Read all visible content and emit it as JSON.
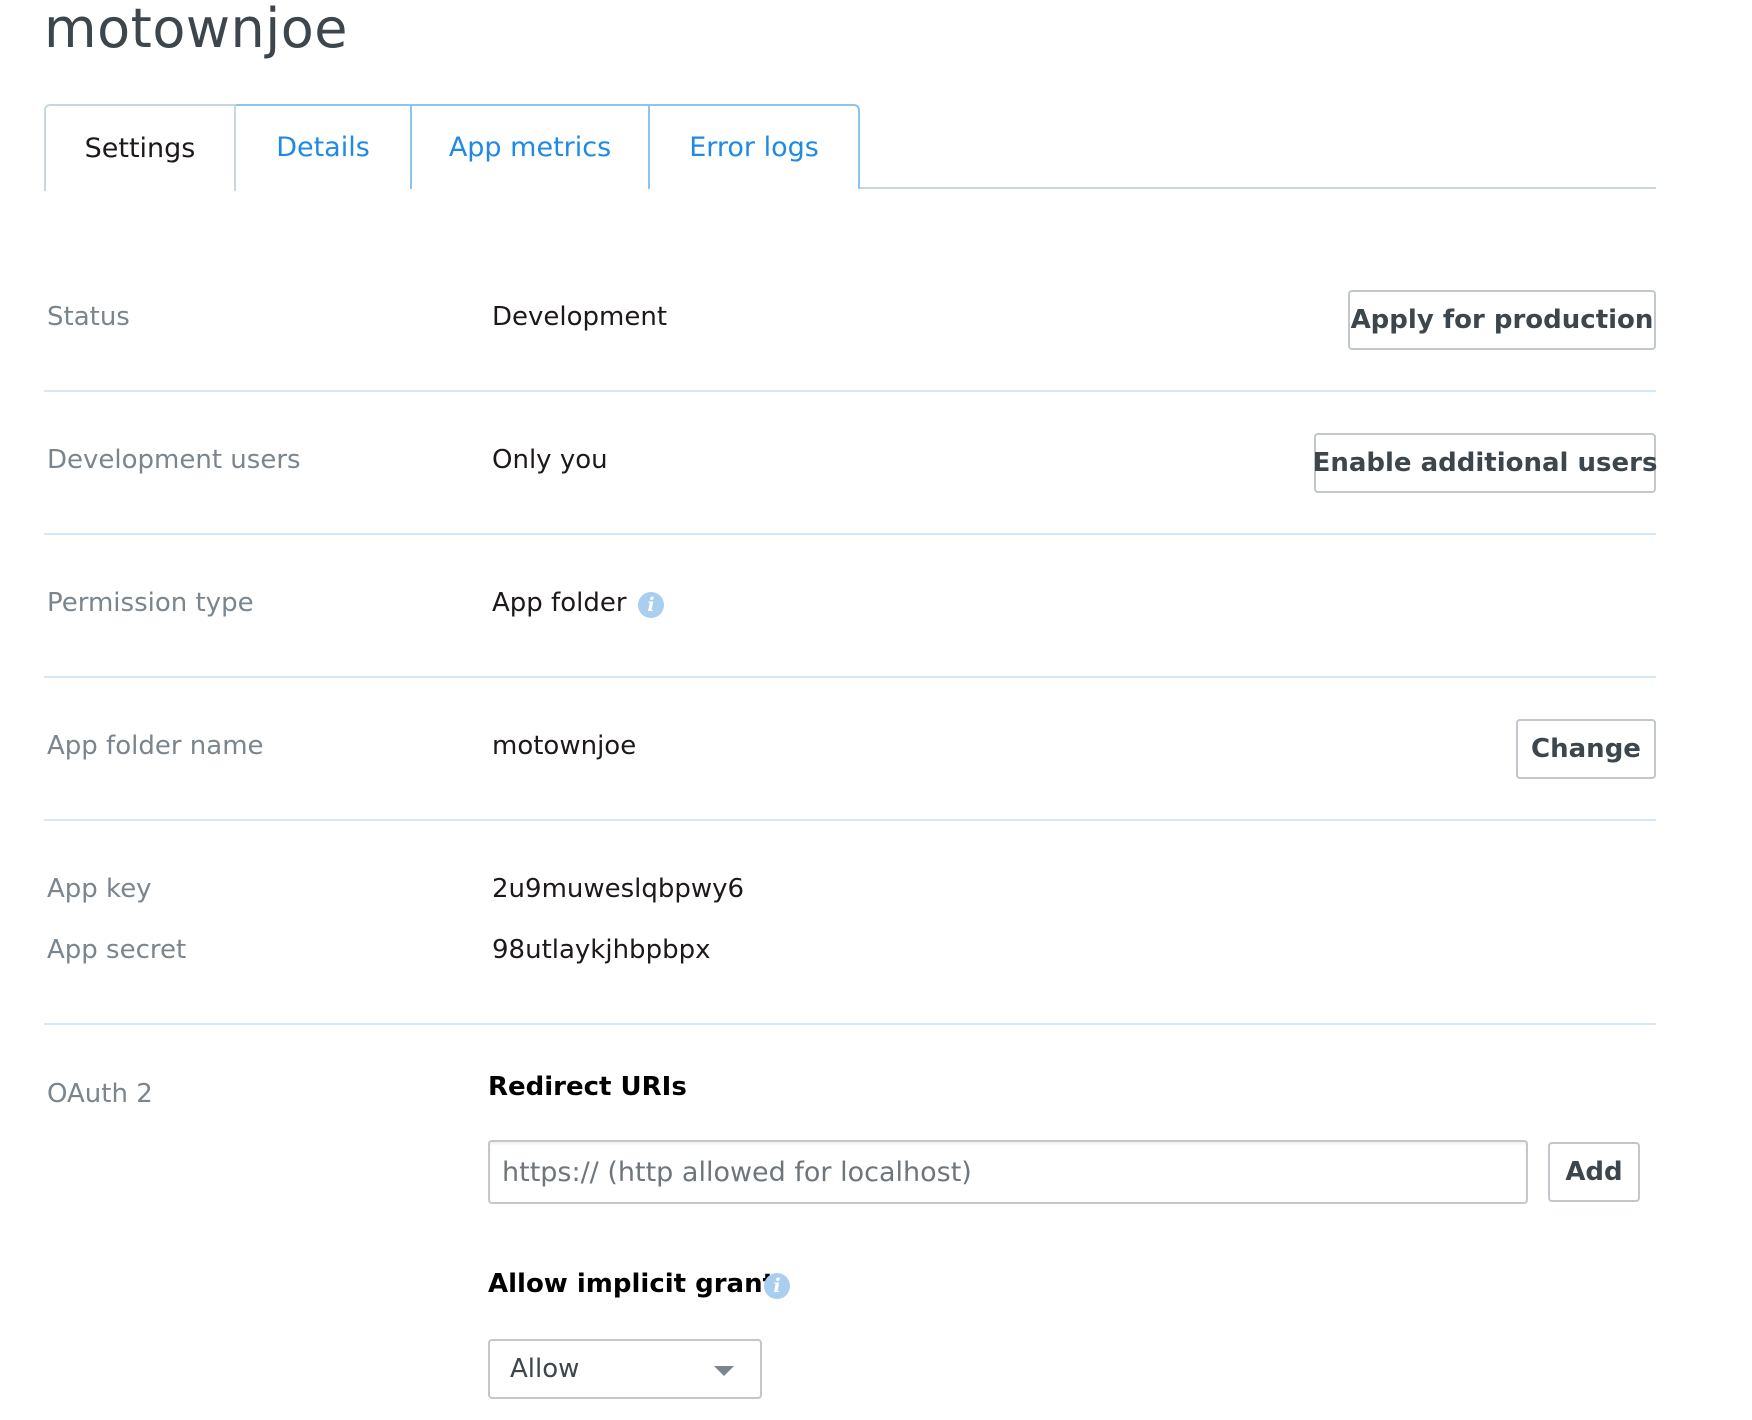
{
  "app": {
    "title": "motownjoe"
  },
  "tabs": [
    {
      "label": "Settings",
      "active": true
    },
    {
      "label": "Details",
      "active": false
    },
    {
      "label": "App metrics",
      "active": false
    },
    {
      "label": "Error logs",
      "active": false
    }
  ],
  "settings": {
    "status": {
      "label": "Status",
      "value": "Development",
      "button": "Apply for production"
    },
    "dev_users": {
      "label": "Development users",
      "value": "Only you",
      "button": "Enable additional users"
    },
    "permission_type": {
      "label": "Permission type",
      "value": "App folder",
      "icon": "info-icon"
    },
    "app_folder_name": {
      "label": "App folder name",
      "value": "motownjoe",
      "button": "Change"
    },
    "app_key": {
      "label": "App key",
      "value": "2u9muweslqbpwy6"
    },
    "app_secret": {
      "label": "App secret",
      "value": "98utlaykjhbpbpx"
    },
    "oauth": {
      "label": "OAuth 2",
      "redirect_heading": "Redirect URIs",
      "redirect_input_value": "",
      "redirect_placeholder": "https:// (http allowed for localhost)",
      "add_button": "Add",
      "implicit_heading": "Allow implicit grant",
      "implicit_icon": "info-icon",
      "implicit_selected": "Allow"
    }
  },
  "colors": {
    "link_blue": "#1f8ae6",
    "label_gray": "#7b858d",
    "divider": "#d6e8f6",
    "info_icon": "#a9cef0"
  }
}
